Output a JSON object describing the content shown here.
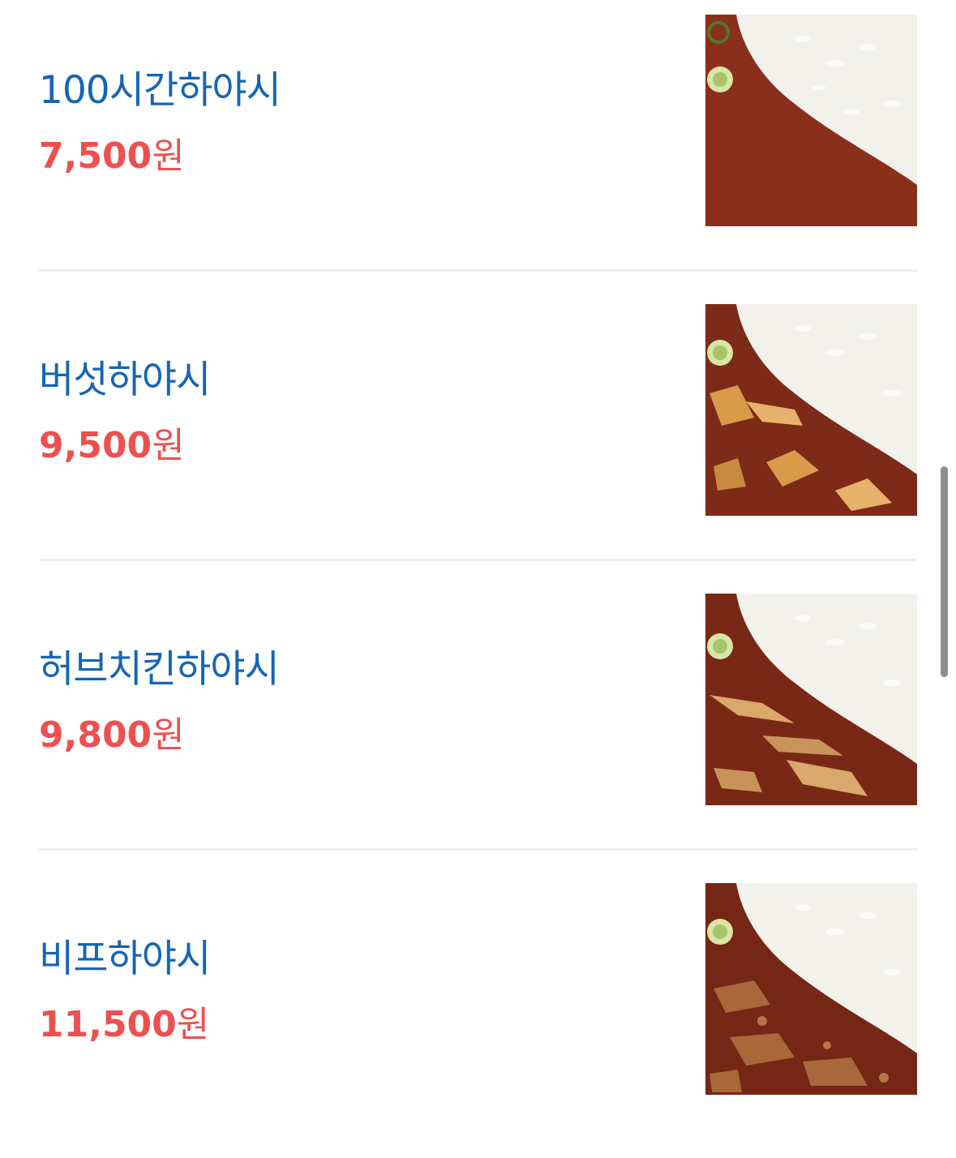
{
  "menu": {
    "items": [
      {
        "name": "100시간하야시",
        "price": "7,500",
        "currency": "원",
        "image": "hayashi-rice-photo",
        "topping": "plain"
      },
      {
        "name": "버섯하야시",
        "price": "9,500",
        "currency": "원",
        "image": "mushroom-hayashi-photo",
        "topping": "mushroom"
      },
      {
        "name": "허브치킨하야시",
        "price": "9,800",
        "currency": "원",
        "image": "herb-chicken-hayashi-photo",
        "topping": "chicken"
      },
      {
        "name": "비프하야시",
        "price": "11,500",
        "currency": "원",
        "image": "beef-hayashi-photo",
        "topping": "beef"
      }
    ]
  },
  "colors": {
    "name": "#1565b4",
    "price": "#ee5050",
    "divider": "#eeeeee",
    "sauce": "#8a2f1c",
    "rice": "#f4f2ee"
  }
}
